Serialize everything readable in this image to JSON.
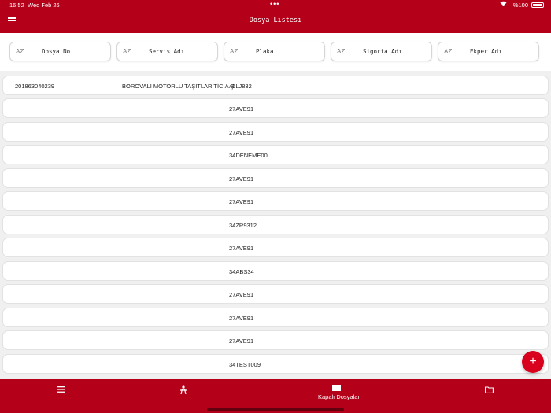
{
  "status": {
    "time": "16:52",
    "date": "Wed Feb 26",
    "battery": "%100",
    "dots": "•••"
  },
  "header": {
    "title": "Dosya Listesi",
    "sort_icon_text": "AZ"
  },
  "filters": [
    {
      "label": "Dosya No"
    },
    {
      "label": "Servis Adı"
    },
    {
      "label": "Plaka"
    },
    {
      "label": "Sigorta Adı"
    },
    {
      "label": "Ekper Adı"
    }
  ],
  "rows": [
    {
      "dosya_no": "201863040239",
      "servis": "BOROVALI MOTORLU TAŞITLAR TİC.A.Ş.",
      "plaka": "45LJ832"
    },
    {
      "dosya_no": "",
      "servis": "",
      "plaka": "27AVE91"
    },
    {
      "dosya_no": "",
      "servis": "",
      "plaka": "27AVE91"
    },
    {
      "dosya_no": "",
      "servis": "",
      "plaka": "34DENEME00"
    },
    {
      "dosya_no": "",
      "servis": "",
      "plaka": "27AVE91"
    },
    {
      "dosya_no": "",
      "servis": "",
      "plaka": "27AVE91"
    },
    {
      "dosya_no": "",
      "servis": "",
      "plaka": "34ZR9312"
    },
    {
      "dosya_no": "",
      "servis": "",
      "plaka": "27AVE91"
    },
    {
      "dosya_no": "",
      "servis": "",
      "plaka": "34ABS34"
    },
    {
      "dosya_no": "",
      "servis": "",
      "plaka": "27AVE91"
    },
    {
      "dosya_no": "",
      "servis": "",
      "plaka": "27AVE91"
    },
    {
      "dosya_no": "",
      "servis": "",
      "plaka": "27AVE91"
    },
    {
      "dosya_no": "",
      "servis": "",
      "plaka": "34TEST009"
    }
  ],
  "fab": {
    "label": "+"
  },
  "bottom_nav": [
    {
      "icon": "list-icon",
      "label": ""
    },
    {
      "icon": "worker-icon",
      "label": ""
    },
    {
      "icon": "folder-filled-icon",
      "label": "Kapalı Dosyalar"
    },
    {
      "icon": "folder-outline-icon",
      "label": ""
    }
  ],
  "colors": {
    "brand": "#b5001a",
    "fab": "#d8001d"
  }
}
